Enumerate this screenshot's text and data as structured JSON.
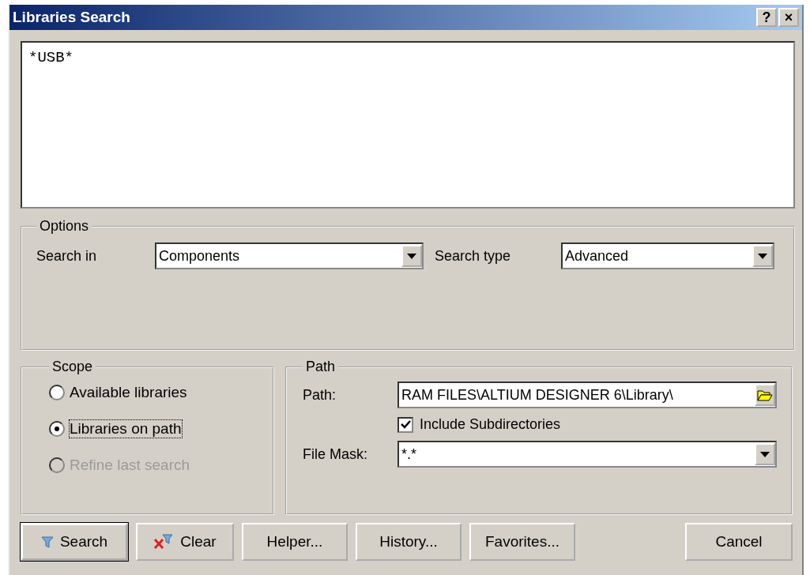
{
  "window": {
    "title": "Libraries Search",
    "title_buttons": [
      "?",
      "×"
    ]
  },
  "query": "*USB*",
  "options": {
    "legend": "Options",
    "search_in": {
      "label": "Search in",
      "value": "Components"
    },
    "search_type": {
      "label": "Search type",
      "value": "Advanced"
    }
  },
  "scope": {
    "legend": "Scope",
    "radios": [
      {
        "label": "Available libraries",
        "selected": false,
        "disabled": false
      },
      {
        "label": "Libraries on path",
        "selected": true,
        "disabled": false
      },
      {
        "label": "Refine last search",
        "selected": false,
        "disabled": true
      }
    ]
  },
  "path": {
    "legend": "Path",
    "path_label": "Path:",
    "path_value": "RAM FILES\\ALTIUM DESIGNER 6\\Library\\",
    "include_subdirectories": {
      "label": "Include Subdirectories",
      "checked": true
    },
    "file_mask_label": "File Mask:",
    "file_mask_value": "*.*"
  },
  "buttons": [
    {
      "label": "Search",
      "kind": "search",
      "default": true
    },
    {
      "label": "Clear",
      "kind": "clear",
      "default": false
    },
    {
      "label": "Helper...",
      "kind": "plain",
      "default": false
    },
    {
      "label": "History...",
      "kind": "plain",
      "default": false
    },
    {
      "label": "Favorites...",
      "kind": "plain",
      "default": false
    },
    {
      "label": "Cancel",
      "kind": "cancel",
      "default": false
    }
  ]
}
